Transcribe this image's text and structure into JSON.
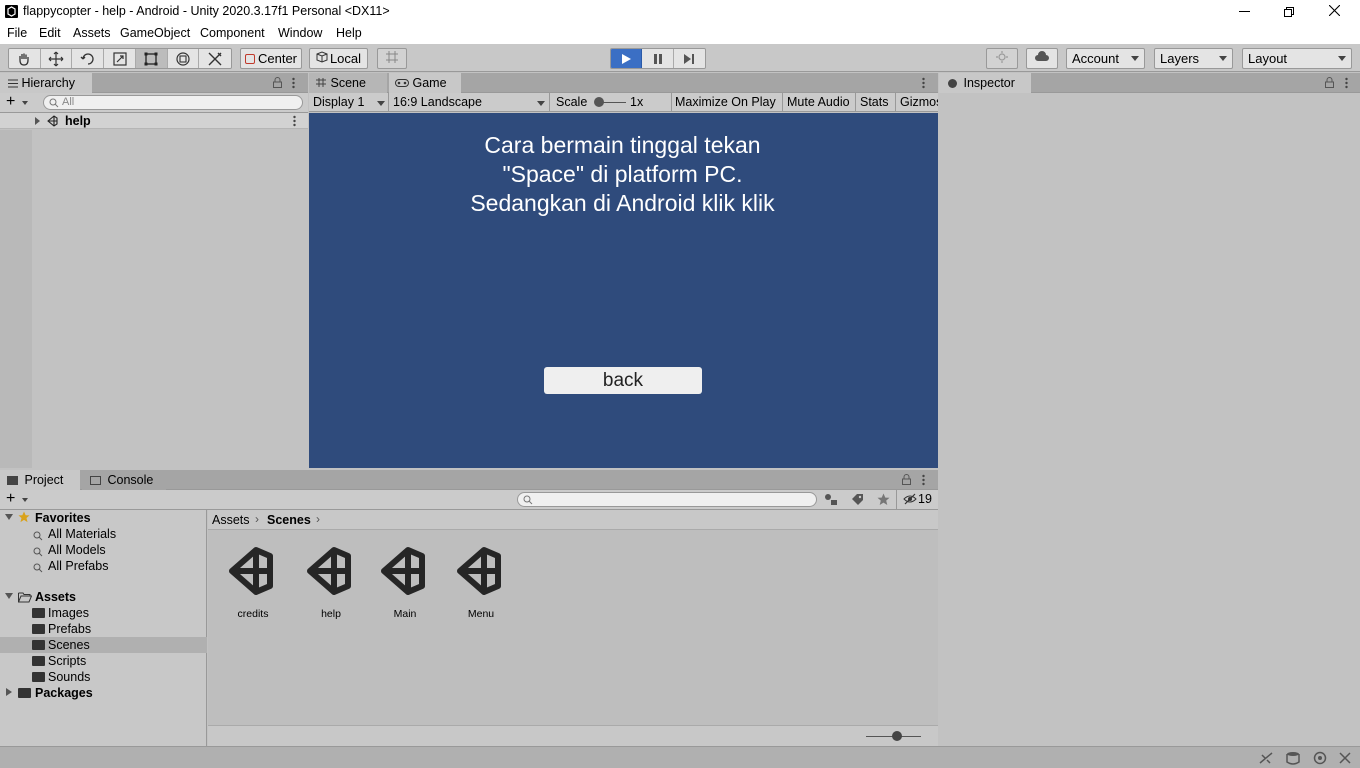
{
  "window": {
    "title": "flappycopter - help - Android - Unity 2020.3.17f1 Personal <DX11>"
  },
  "menubar": [
    "File",
    "Edit",
    "Assets",
    "GameObject",
    "Component",
    "Window",
    "Help"
  ],
  "toolbar": {
    "pivot_label": "Center",
    "space_label": "Local",
    "account_label": "Account",
    "layers_label": "Layers",
    "layout_label": "Layout"
  },
  "hierarchy": {
    "tab": "Hierarchy",
    "search_placeholder": "All",
    "scene_name": "help"
  },
  "center": {
    "tabs": [
      "Scene",
      "Game"
    ],
    "game_toolbar": {
      "display": "Display 1",
      "aspect": "16:9 Landscape",
      "scale_label": "Scale",
      "scale_value": "1x",
      "maximize": "Maximize On Play",
      "mute": "Mute Audio",
      "stats": "Stats",
      "gizmos": "Gizmos"
    },
    "game_view": {
      "background": "#2f4b7c",
      "line1": "Cara bermain tinggal tekan",
      "line2": "\"Space\" di platform PC.",
      "line3": "Sedangkan di Android klik klik",
      "back_button": "back"
    }
  },
  "inspector": {
    "tab": "Inspector"
  },
  "project": {
    "tabs": [
      "Project",
      "Console"
    ],
    "hidden_count": "19",
    "favorites": {
      "label": "Favorites",
      "items": [
        "All Materials",
        "All Models",
        "All Prefabs"
      ]
    },
    "assets": {
      "label": "Assets",
      "items": [
        "Images",
        "Prefabs",
        "Scenes",
        "Scripts",
        "Sounds"
      ]
    },
    "packages_label": "Packages",
    "breadcrumb": [
      "Assets",
      "Scenes"
    ],
    "files": [
      "credits",
      "help",
      "Main",
      "Menu"
    ]
  },
  "colors": {
    "accent_play": "#3b6fc4",
    "selection": "#b0b0b0"
  }
}
